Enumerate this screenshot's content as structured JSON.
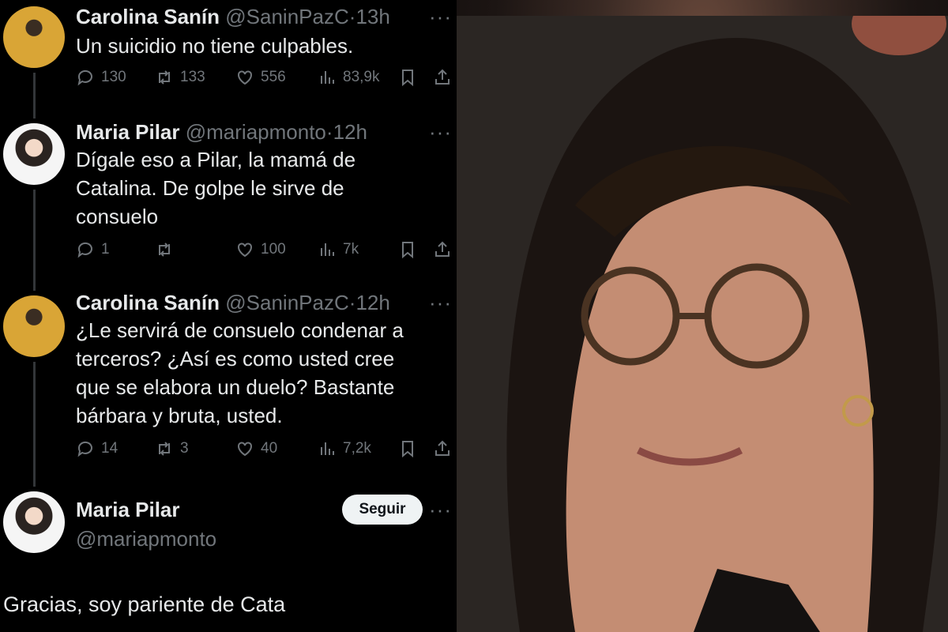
{
  "tweets": [
    {
      "name": "Carolina Sanín",
      "handle": "@SaninPazC",
      "time": "13h",
      "text": "Un suicidio no tiene culpables.",
      "replies": "130",
      "retweets": "133",
      "likes": "556",
      "views": "83,9k"
    },
    {
      "name": "Maria Pilar",
      "handle": "@mariapmonto",
      "time": "12h",
      "text": [
        "Dígale eso a Pilar, la mamá de",
        "Catalina. De golpe le sirve de",
        "consuelo"
      ],
      "replies": "1",
      "retweets": "",
      "likes": "100",
      "views": "7k"
    },
    {
      "name": "Carolina Sanín",
      "handle": "@SaninPazC",
      "time": "12h",
      "text": [
        "¿Le servirá de consuelo condenar a",
        "terceros? ¿Así es como usted cree",
        "que se elabora un duelo? Bastante",
        "bárbara y bruta, usted."
      ],
      "replies": "14",
      "retweets": "3",
      "likes": "40",
      "views": "7,2k"
    }
  ],
  "last": {
    "name": "Maria Pilar",
    "handle": "@mariapmonto",
    "follow_label": "Seguir",
    "text": "Gracias, soy pariente de Cata"
  },
  "more_label": "···",
  "icons": [
    "reply-icon",
    "retweet-icon",
    "like-icon",
    "views-icon",
    "bookmark-icon",
    "share-icon"
  ]
}
